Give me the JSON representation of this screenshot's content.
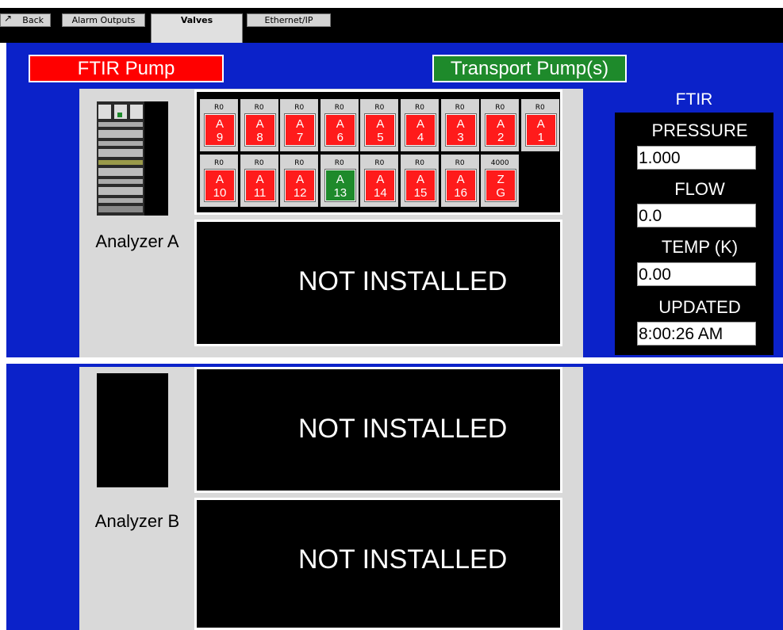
{
  "tabs": {
    "back": "Back",
    "alarm_outputs": "Alarm Outputs",
    "valves": "Valves",
    "ethernet": "Ethernet/IP"
  },
  "pumps": {
    "ftir": "FTIR Pump",
    "transport": "Transport Pump(s)"
  },
  "analyzer_a": {
    "label": "Analyzer A",
    "lower_status": "NOT INSTALLED",
    "valves": [
      {
        "cap": "R0",
        "line1": "A",
        "line2": "9",
        "state": "red"
      },
      {
        "cap": "R0",
        "line1": "A",
        "line2": "8",
        "state": "red"
      },
      {
        "cap": "R0",
        "line1": "A",
        "line2": "7",
        "state": "red"
      },
      {
        "cap": "R0",
        "line1": "A",
        "line2": "6",
        "state": "red"
      },
      {
        "cap": "R0",
        "line1": "A",
        "line2": "5",
        "state": "red"
      },
      {
        "cap": "R0",
        "line1": "A",
        "line2": "4",
        "state": "red"
      },
      {
        "cap": "R0",
        "line1": "A",
        "line2": "3",
        "state": "red"
      },
      {
        "cap": "R0",
        "line1": "A",
        "line2": "2",
        "state": "red"
      },
      {
        "cap": "R0",
        "line1": "A",
        "line2": "1",
        "state": "red"
      },
      {
        "cap": "R0",
        "line1": "A",
        "line2": "10",
        "state": "red"
      },
      {
        "cap": "R0",
        "line1": "A",
        "line2": "11",
        "state": "red"
      },
      {
        "cap": "R0",
        "line1": "A",
        "line2": "12",
        "state": "red"
      },
      {
        "cap": "R0",
        "line1": "A",
        "line2": "13",
        "state": "green"
      },
      {
        "cap": "R0",
        "line1": "A",
        "line2": "14",
        "state": "red"
      },
      {
        "cap": "R0",
        "line1": "A",
        "line2": "15",
        "state": "red"
      },
      {
        "cap": "R0",
        "line1": "A",
        "line2": "16",
        "state": "red"
      },
      {
        "cap": "4000",
        "line1": "Z",
        "line2": "G",
        "state": "red"
      }
    ]
  },
  "analyzer_b": {
    "label": "Analyzer B",
    "upper_status": "NOT INSTALLED",
    "lower_status": "NOT INSTALLED"
  },
  "ftir": {
    "title": "FTIR",
    "pressure_label": "PRESSURE",
    "pressure_value": "1.000",
    "flow_label": "FLOW",
    "flow_value": "0.0",
    "temp_label": "TEMP (K)",
    "temp_value": "0.00",
    "updated_label": "UPDATED",
    "updated_value": "8:00:26 AM"
  },
  "colors": {
    "background_blue": "#0b22c9",
    "valve_red": "#ff1b1b",
    "valve_green": "#1e8a2b",
    "panel_gray": "#d9d9d9"
  }
}
